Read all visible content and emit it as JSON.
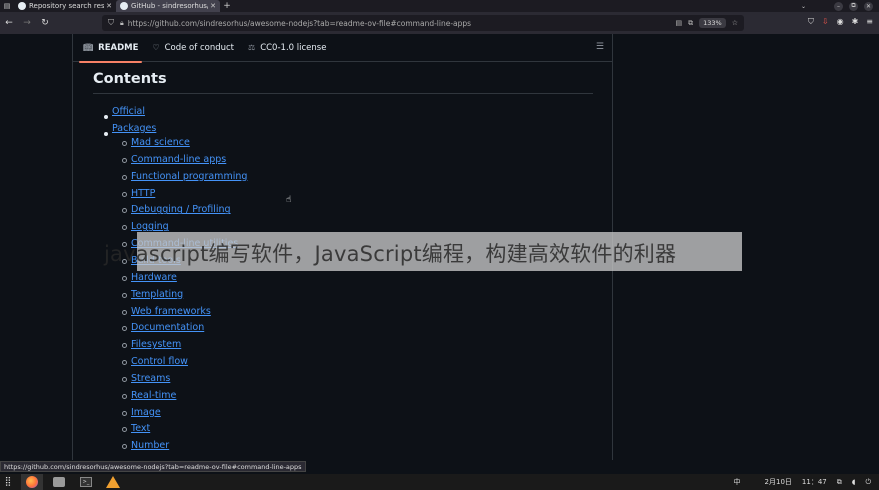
{
  "browser": {
    "tabs": [
      {
        "title": "Repository search results"
      },
      {
        "title": "GitHub - sindresorhus/awesome-nodejs"
      }
    ],
    "url": "https://github.com/sindresorhus/awesome-nodejs?tab=readme-ov-file#command-line-apps",
    "zoom": "133%",
    "status_url": "https://github.com/sindresorhus/awesome-nodejs?tab=readme-ov-file#command-line-apps"
  },
  "readme_tabs": {
    "readme": "README",
    "conduct": "Code of conduct",
    "license": "CC0-1.0 license"
  },
  "contents": {
    "heading": "Contents",
    "top_items": [
      "Official",
      "Packages"
    ],
    "sub_items": [
      "Mad science",
      "Command-line apps",
      "Functional programming",
      "HTTP",
      "Debugging / Profiling",
      "Logging",
      "Command-line utilities",
      "Build tools",
      "Hardware",
      "Templating",
      "Web frameworks",
      "Documentation",
      "Filesystem",
      "Control flow",
      "Streams",
      "Real-time",
      "Image",
      "Text",
      "Number"
    ]
  },
  "overlay": {
    "text": "javascript编写软件，JavaScript编程，构建高效软件的利器"
  },
  "taskbar": {
    "ime": "中",
    "date": "2月10日",
    "time": "11：47"
  },
  "icons": {
    "readme": "book-icon",
    "conduct": "heart-icon",
    "license": "scale-icon"
  }
}
